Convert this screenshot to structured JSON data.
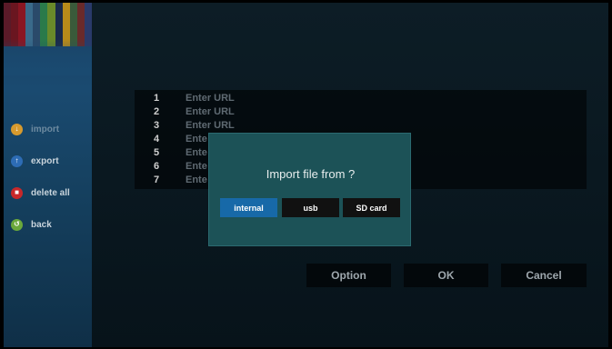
{
  "colors": {
    "accent": "#1769a8",
    "dialog_bg": "#1c5257",
    "sidebar_bg": "#1a4a70",
    "stripes": [
      "#5a1a28",
      "#6a1620",
      "#8a1622",
      "#3a6a8a",
      "#2a4a6a",
      "#2a7a4a",
      "#6a8a2a",
      "#1a2a4a",
      "#b88a1a",
      "#3a5a3a",
      "#6a2a2a",
      "#2a3a6a"
    ]
  },
  "sidebar": {
    "items": [
      {
        "label": "import",
        "icon": "download-icon",
        "glyph": "↓"
      },
      {
        "label": "export",
        "icon": "upload-icon",
        "glyph": "↑"
      },
      {
        "label": "delete all",
        "icon": "trash-icon",
        "glyph": "■"
      },
      {
        "label": "back",
        "icon": "back-icon",
        "glyph": "↺"
      }
    ]
  },
  "url_list": {
    "rows": [
      {
        "num": "1",
        "value": "Enter URL"
      },
      {
        "num": "2",
        "value": "Enter URL"
      },
      {
        "num": "3",
        "value": "Enter URL"
      },
      {
        "num": "4",
        "value": "Ente"
      },
      {
        "num": "5",
        "value": "Ente"
      },
      {
        "num": "6",
        "value": "Ente"
      },
      {
        "num": "7",
        "value": "Ente"
      }
    ]
  },
  "bottom_buttons": {
    "option": "Option",
    "ok": "OK",
    "cancel": "Cancel"
  },
  "dialog": {
    "title": "Import file from ?",
    "buttons": {
      "internal": "internal",
      "usb": "usb",
      "sdcard": "SD card"
    },
    "selected": "internal"
  }
}
